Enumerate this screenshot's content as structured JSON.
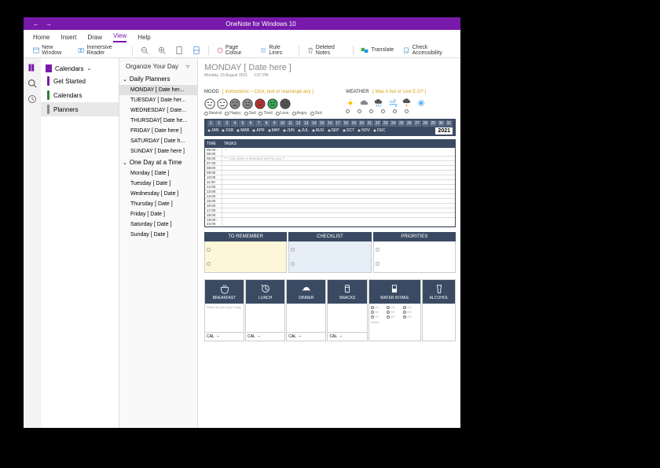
{
  "app_title": "OneNote for Windows 10",
  "menu_tabs": [
    "Home",
    "Insert",
    "Draw",
    "View",
    "Help"
  ],
  "active_menu": "View",
  "ribbon": {
    "new_window": "New Window",
    "immersive": "Immersive Reader",
    "page_colour": "Page Colour",
    "rule_lines": "Rule Lines",
    "deleted_notes": "Deleted Notes",
    "translate": "Translate",
    "check_access": "Check Accessibility"
  },
  "notebook_selector": "Calendars",
  "notebooks": [
    {
      "label": "Get Started",
      "color": "c-purple"
    },
    {
      "label": "Calendars",
      "color": "c-green"
    },
    {
      "label": "Planners",
      "color": "c-gray",
      "selected": true
    }
  ],
  "sections": {
    "title": "Organize Your Day",
    "groups": [
      {
        "label": "Daily Planners",
        "expanded": true,
        "pages": [
          {
            "label": "MONDAY [ Date her...",
            "selected": true
          },
          {
            "label": "TUESDAY [ Date her..."
          },
          {
            "label": "WEDNESDAY [ Date..."
          },
          {
            "label": "THURSDAY[ Date he..."
          },
          {
            "label": "FRIDAY [ Date here ]"
          },
          {
            "label": "SATURDAY [ Date h..."
          },
          {
            "label": "SUNDAY [ Date here ]"
          }
        ]
      },
      {
        "label": "One Day at a Time",
        "expanded": true,
        "pages": [
          {
            "label": "Monday [ Date ]"
          },
          {
            "label": "Tuesday [ Date ]"
          },
          {
            "label": "Wednesday [ Date ]"
          },
          {
            "label": "Thursday [ Date ]"
          },
          {
            "label": "Friday [ Date ]"
          },
          {
            "label": "Saturday [ Date ]"
          },
          {
            "label": "Sunday [ Date ]"
          }
        ]
      }
    ]
  },
  "page": {
    "title": "MONDAY [ Date here ]",
    "date": "Monday, 23 August 2021",
    "time": "2:07 PM",
    "mood_label": "MOOD",
    "mood_hint": "[ instructions – Click, text or rearrange any ]",
    "moods": [
      "Neutral",
      "Happy",
      "Sad",
      "Tired",
      "Love",
      "Angry",
      "Sick"
    ],
    "weather_label": "WEATHER",
    "weather_hint": "[ Was it hot or cool E.G? ]",
    "cal_days": [
      "1",
      "2",
      "3",
      "4",
      "5",
      "6",
      "7",
      "8",
      "9",
      "10",
      "11",
      "12",
      "13",
      "14",
      "15",
      "16",
      "17",
      "18",
      "19",
      "20",
      "21",
      "22",
      "23",
      "24",
      "25",
      "26",
      "27",
      "28",
      "29",
      "30",
      "31"
    ],
    "cal_months": [
      "JAN",
      "FEB",
      "MAR",
      "APR",
      "MAY",
      "JUN",
      "JUL",
      "AUG",
      "SEP",
      "OCT",
      "NOV",
      "DEC"
    ],
    "year": "2021",
    "sched_head_time": "TIME",
    "sched_head_tasks": "TASKS",
    "sched_rows": [
      {
        "t": "05:00 -\n06:00",
        "v": "---"
      },
      {
        "t": "06:00",
        "v": "** I only done a standard one for you **"
      },
      {
        "t": "07:00",
        "v": ""
      },
      {
        "t": "08:00",
        "v": ""
      },
      {
        "t": "09:00",
        "v": ""
      },
      {
        "t": "10:00",
        "v": ""
      },
      {
        "t": "11:00",
        "v": ""
      },
      {
        "t": "12:00",
        "v": ""
      },
      {
        "t": "13:00",
        "v": ""
      },
      {
        "t": "14:00",
        "v": ""
      },
      {
        "t": "15:00",
        "v": ""
      },
      {
        "t": "16:00",
        "v": ""
      },
      {
        "t": "17:00",
        "v": ""
      },
      {
        "t": "18:00",
        "v": ""
      },
      {
        "t": "19:00 -\n24:00",
        "v": ""
      }
    ],
    "boxes": [
      "TO REMEMBER",
      "CHECKLIST",
      "PRIORITIES"
    ],
    "meals": [
      {
        "h": "BREAKFAST",
        "foot": "CAL",
        "hint": "What did you have today"
      },
      {
        "h": "LUNCH",
        "foot": "CAL"
      },
      {
        "h": "DINNER",
        "foot": "CAL"
      },
      {
        "h": "SNACKS",
        "foot": "CAL"
      },
      {
        "h": "WATER INTAKE",
        "water": [
          "1G",
          "2G",
          "3G",
          "4G",
          "5G",
          "6G",
          "7G",
          "8G",
          "9G"
        ],
        "note": "Notes"
      },
      {
        "h": "ALCOHOL"
      }
    ],
    "dash": "--"
  }
}
